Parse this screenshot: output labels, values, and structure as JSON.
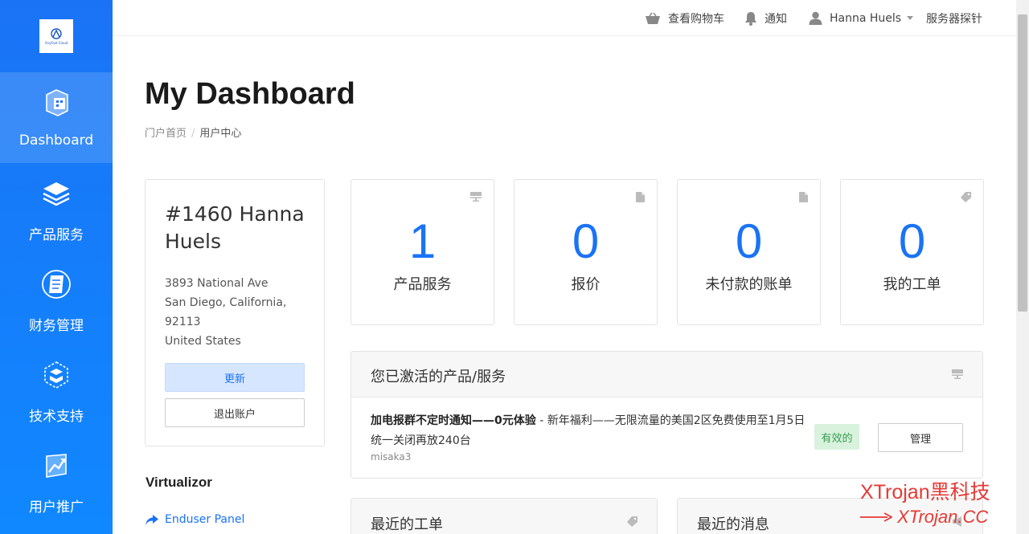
{
  "brand": {
    "logo_text": "AnyFast Cloud"
  },
  "sidebar": {
    "items": [
      {
        "label": "Dashboard",
        "icon": "dashboard-icon",
        "active": true
      },
      {
        "label": "产品服务",
        "icon": "layers-icon"
      },
      {
        "label": "财务管理",
        "icon": "document-icon"
      },
      {
        "label": "技术支持",
        "icon": "support-box-icon"
      },
      {
        "label": "用户推广",
        "icon": "chart-icon"
      }
    ]
  },
  "topbar": {
    "cart": "查看购物车",
    "notify": "通知",
    "user": "Hanna Huels",
    "probe": "服务器探针"
  },
  "page": {
    "title": "My Dashboard",
    "breadcrumb": [
      "门户首页",
      "用户中心"
    ]
  },
  "profile": {
    "name": "#1460 Hanna Huels",
    "address_lines": [
      "3893 National Ave",
      "San Diego, California,",
      "92113",
      "United States"
    ],
    "update_label": "更新",
    "logout_label": "退出账户"
  },
  "stats": [
    {
      "value": "1",
      "label": "产品服务",
      "icon": "server-icon"
    },
    {
      "value": "0",
      "label": "报价",
      "icon": "file-icon"
    },
    {
      "value": "0",
      "label": "未付款的账单",
      "icon": "file-icon"
    },
    {
      "value": "0",
      "label": "我的工单",
      "icon": "tag-icon"
    }
  ],
  "services_panel": {
    "title": "您已激活的产品/服务",
    "item": {
      "name": "加电报群不定时通知——0元体验",
      "desc": " - 新年福利——无限流量的美国2区免费使用至1月5日统一关闭再放240台",
      "sub": "misaka3",
      "status": "有效的",
      "manage_label": "管理"
    }
  },
  "virtualizor": {
    "title": "Virtualizor",
    "link": "Enduser Panel"
  },
  "tickets_panel": {
    "title": "最近的工单"
  },
  "news_panel": {
    "title": "最近的消息"
  },
  "watermark": {
    "line1": "XTrojan黑科技",
    "line2": "XTrojan.CC"
  },
  "colors": {
    "sidebar": "#1a73f5",
    "accent": "#1a73f5",
    "success_bg": "#d8f2dd",
    "success_text": "#3a9d50"
  }
}
